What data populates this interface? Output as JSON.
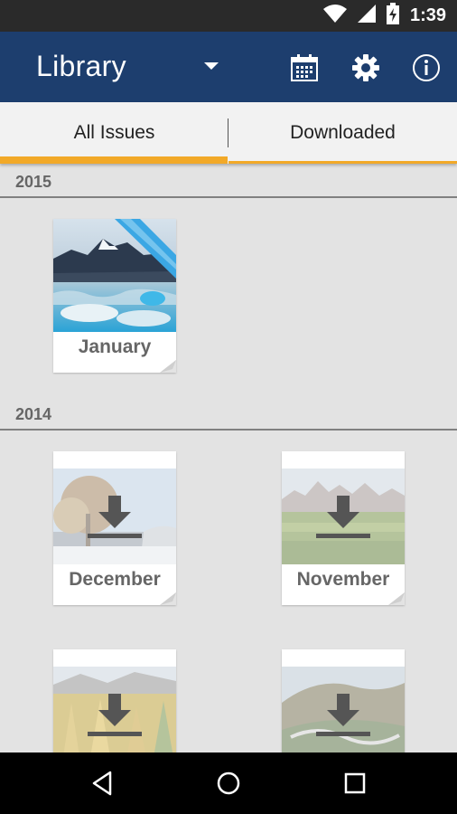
{
  "status_bar": {
    "time": "1:39",
    "icons": [
      "wifi-icon",
      "signal-icon",
      "battery-charging-icon"
    ]
  },
  "app_bar": {
    "title": "Library",
    "actions": [
      "calendar-icon",
      "settings-gear-icon",
      "info-icon"
    ],
    "color": "#1d3e6e"
  },
  "tabs": [
    {
      "label": "All Issues",
      "active": true
    },
    {
      "label": "Downloaded",
      "active": false
    }
  ],
  "accent_color": "#f2a928",
  "sections": [
    {
      "year": "2015",
      "issues": [
        {
          "label": "January",
          "downloaded": true,
          "badge": "new-ribbon"
        }
      ]
    },
    {
      "year": "2014",
      "issues": [
        {
          "label": "December",
          "downloaded": false
        },
        {
          "label": "November",
          "downloaded": false
        },
        {
          "label": "",
          "downloaded": false
        },
        {
          "label": "",
          "downloaded": false
        }
      ]
    }
  ],
  "nav_bar": {
    "buttons": [
      "back-icon",
      "home-icon",
      "recents-icon"
    ]
  }
}
